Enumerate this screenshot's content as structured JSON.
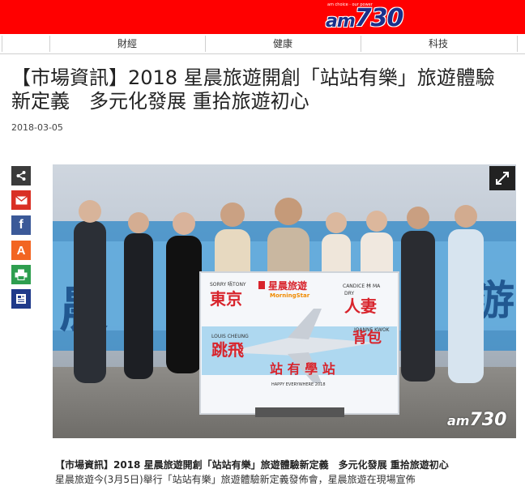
{
  "header": {
    "logo_am": "am",
    "logo_num": "730",
    "logo_tagline": "am choice · our power"
  },
  "nav": {
    "items": [
      {
        "label": "財經"
      },
      {
        "label": "健康"
      },
      {
        "label": "科技"
      }
    ]
  },
  "article": {
    "title": "【市場資訊】2018 星晨旅遊開創「站站有樂」旅遊體驗新定義　多元化發展 重拾旅遊初心",
    "date": "2018-03-05",
    "caption": "【市場資訊】2018 星晨旅遊開創「站站有樂」旅遊體驗新定義　多元化發展 重拾旅遊初心",
    "caption_next": "星晨旅遊今(3月5日)舉行「站站有樂」旅遊體驗新定義發佈會，星晨旅遊在現場宣佈"
  },
  "photo": {
    "watermark_am": "am",
    "watermark_num": "730",
    "board": {
      "brand": "星晨旅遊",
      "brand_en": "MorningStar",
      "tokyo": "東京",
      "tokyo_name": "SORRY 唔TONY",
      "wife": "人妻",
      "wife_name": "CANDICE 林 MA",
      "dry": "DRY",
      "hop": "跳飛",
      "hop_name": "LOUIS CHEUNG",
      "backpack": "背包",
      "backpack_name": "JOANNE KWOK",
      "slogan": "站 有 學 站",
      "happy": "HAPPY EVERYWHERE 2018"
    }
  },
  "share": {
    "items": [
      {
        "icon": "share-icon",
        "color": "#3b3b3b"
      },
      {
        "icon": "email-icon",
        "color": "#d93025"
      },
      {
        "icon": "facebook-icon",
        "color": "#3b5998"
      },
      {
        "icon": "font-size-icon",
        "color": "#f26522"
      },
      {
        "icon": "print-icon",
        "color": "#2e9e4f"
      },
      {
        "icon": "news-icon",
        "color": "#1f3a8a"
      }
    ]
  },
  "colors": {
    "brand_red": "#ff0000",
    "logo_blue": "#1a2f8a"
  }
}
